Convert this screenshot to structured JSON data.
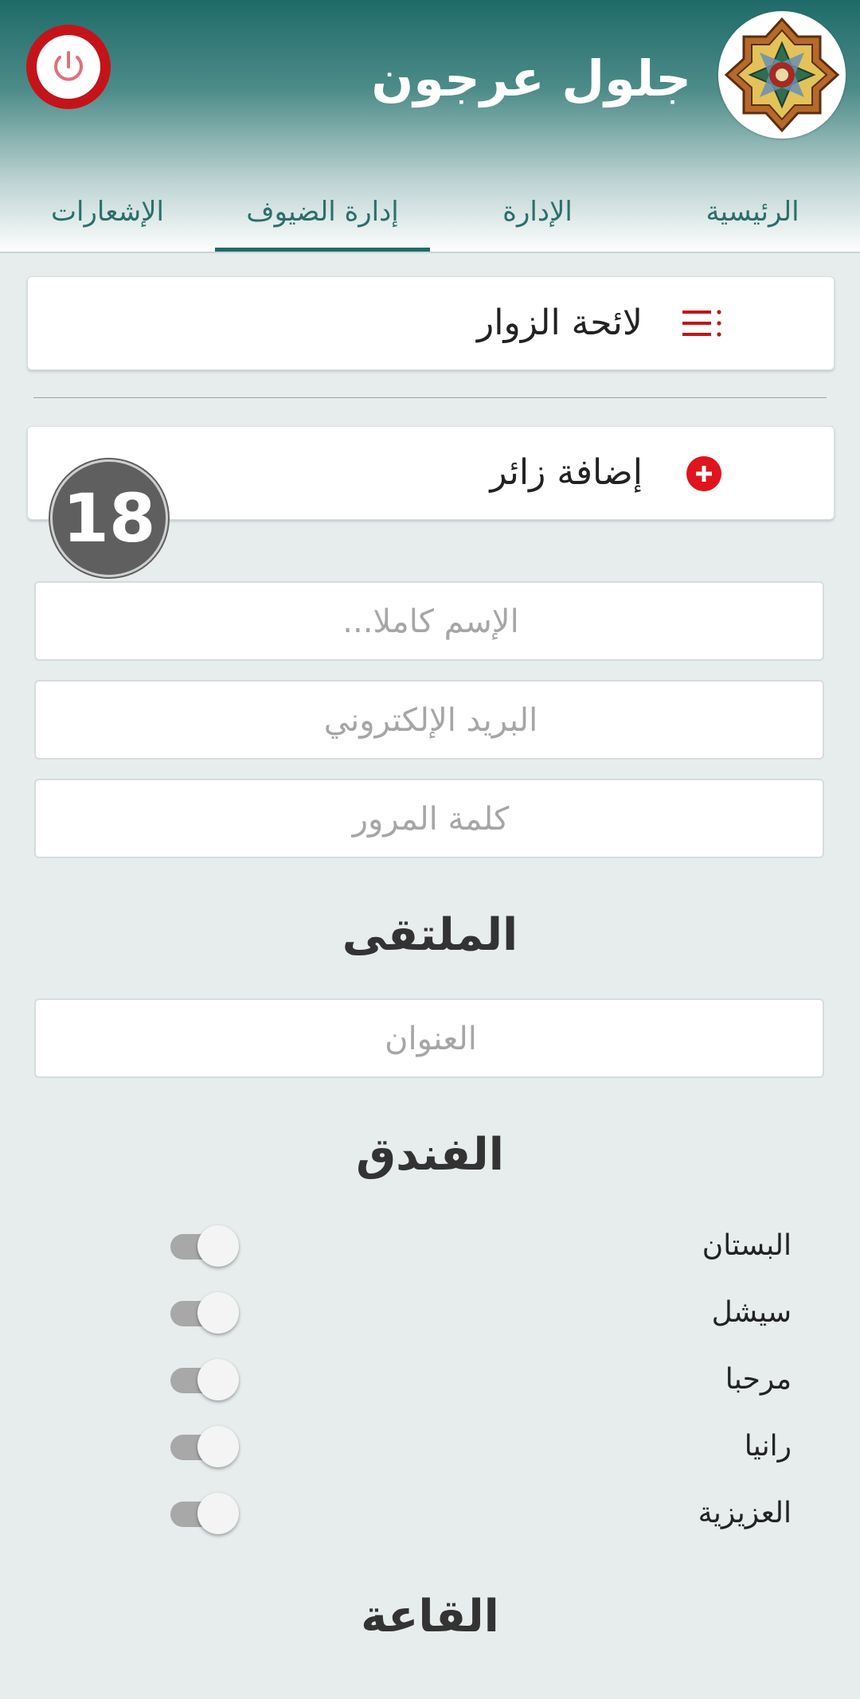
{
  "app": {
    "title": "جلول عرجون"
  },
  "tabs": [
    {
      "label": "الرئيسية"
    },
    {
      "label": "الإدارة"
    },
    {
      "label": "إدارة الضيوف"
    },
    {
      "label": "الإشعارات"
    }
  ],
  "active_tab": "إدارة الضيوف",
  "visitors_list": {
    "label": "لائحة الزوار"
  },
  "add_visitor": {
    "label": "إضافة زائر"
  },
  "badge": {
    "count": "18"
  },
  "form": {
    "full_name": {
      "placeholder": "الإسم كاملا...",
      "value": ""
    },
    "email": {
      "placeholder": "البريد الإلكتروني",
      "value": ""
    },
    "password": {
      "placeholder": "كلمة المرور",
      "value": ""
    }
  },
  "forum": {
    "title": "الملتقى",
    "address": {
      "placeholder": "العنوان",
      "value": ""
    }
  },
  "hotel": {
    "title": "الفندق",
    "options": [
      {
        "label": "البستان",
        "on": false
      },
      {
        "label": "سيشل",
        "on": false
      },
      {
        "label": "مرحبا",
        "on": false
      },
      {
        "label": "رانيا",
        "on": false
      },
      {
        "label": "العزيزية",
        "on": false
      }
    ]
  },
  "hall": {
    "title": "القاعة"
  },
  "colors": {
    "brand": "#1f6b69",
    "accent_red": "#c4141a",
    "background": "#e7ecec"
  }
}
